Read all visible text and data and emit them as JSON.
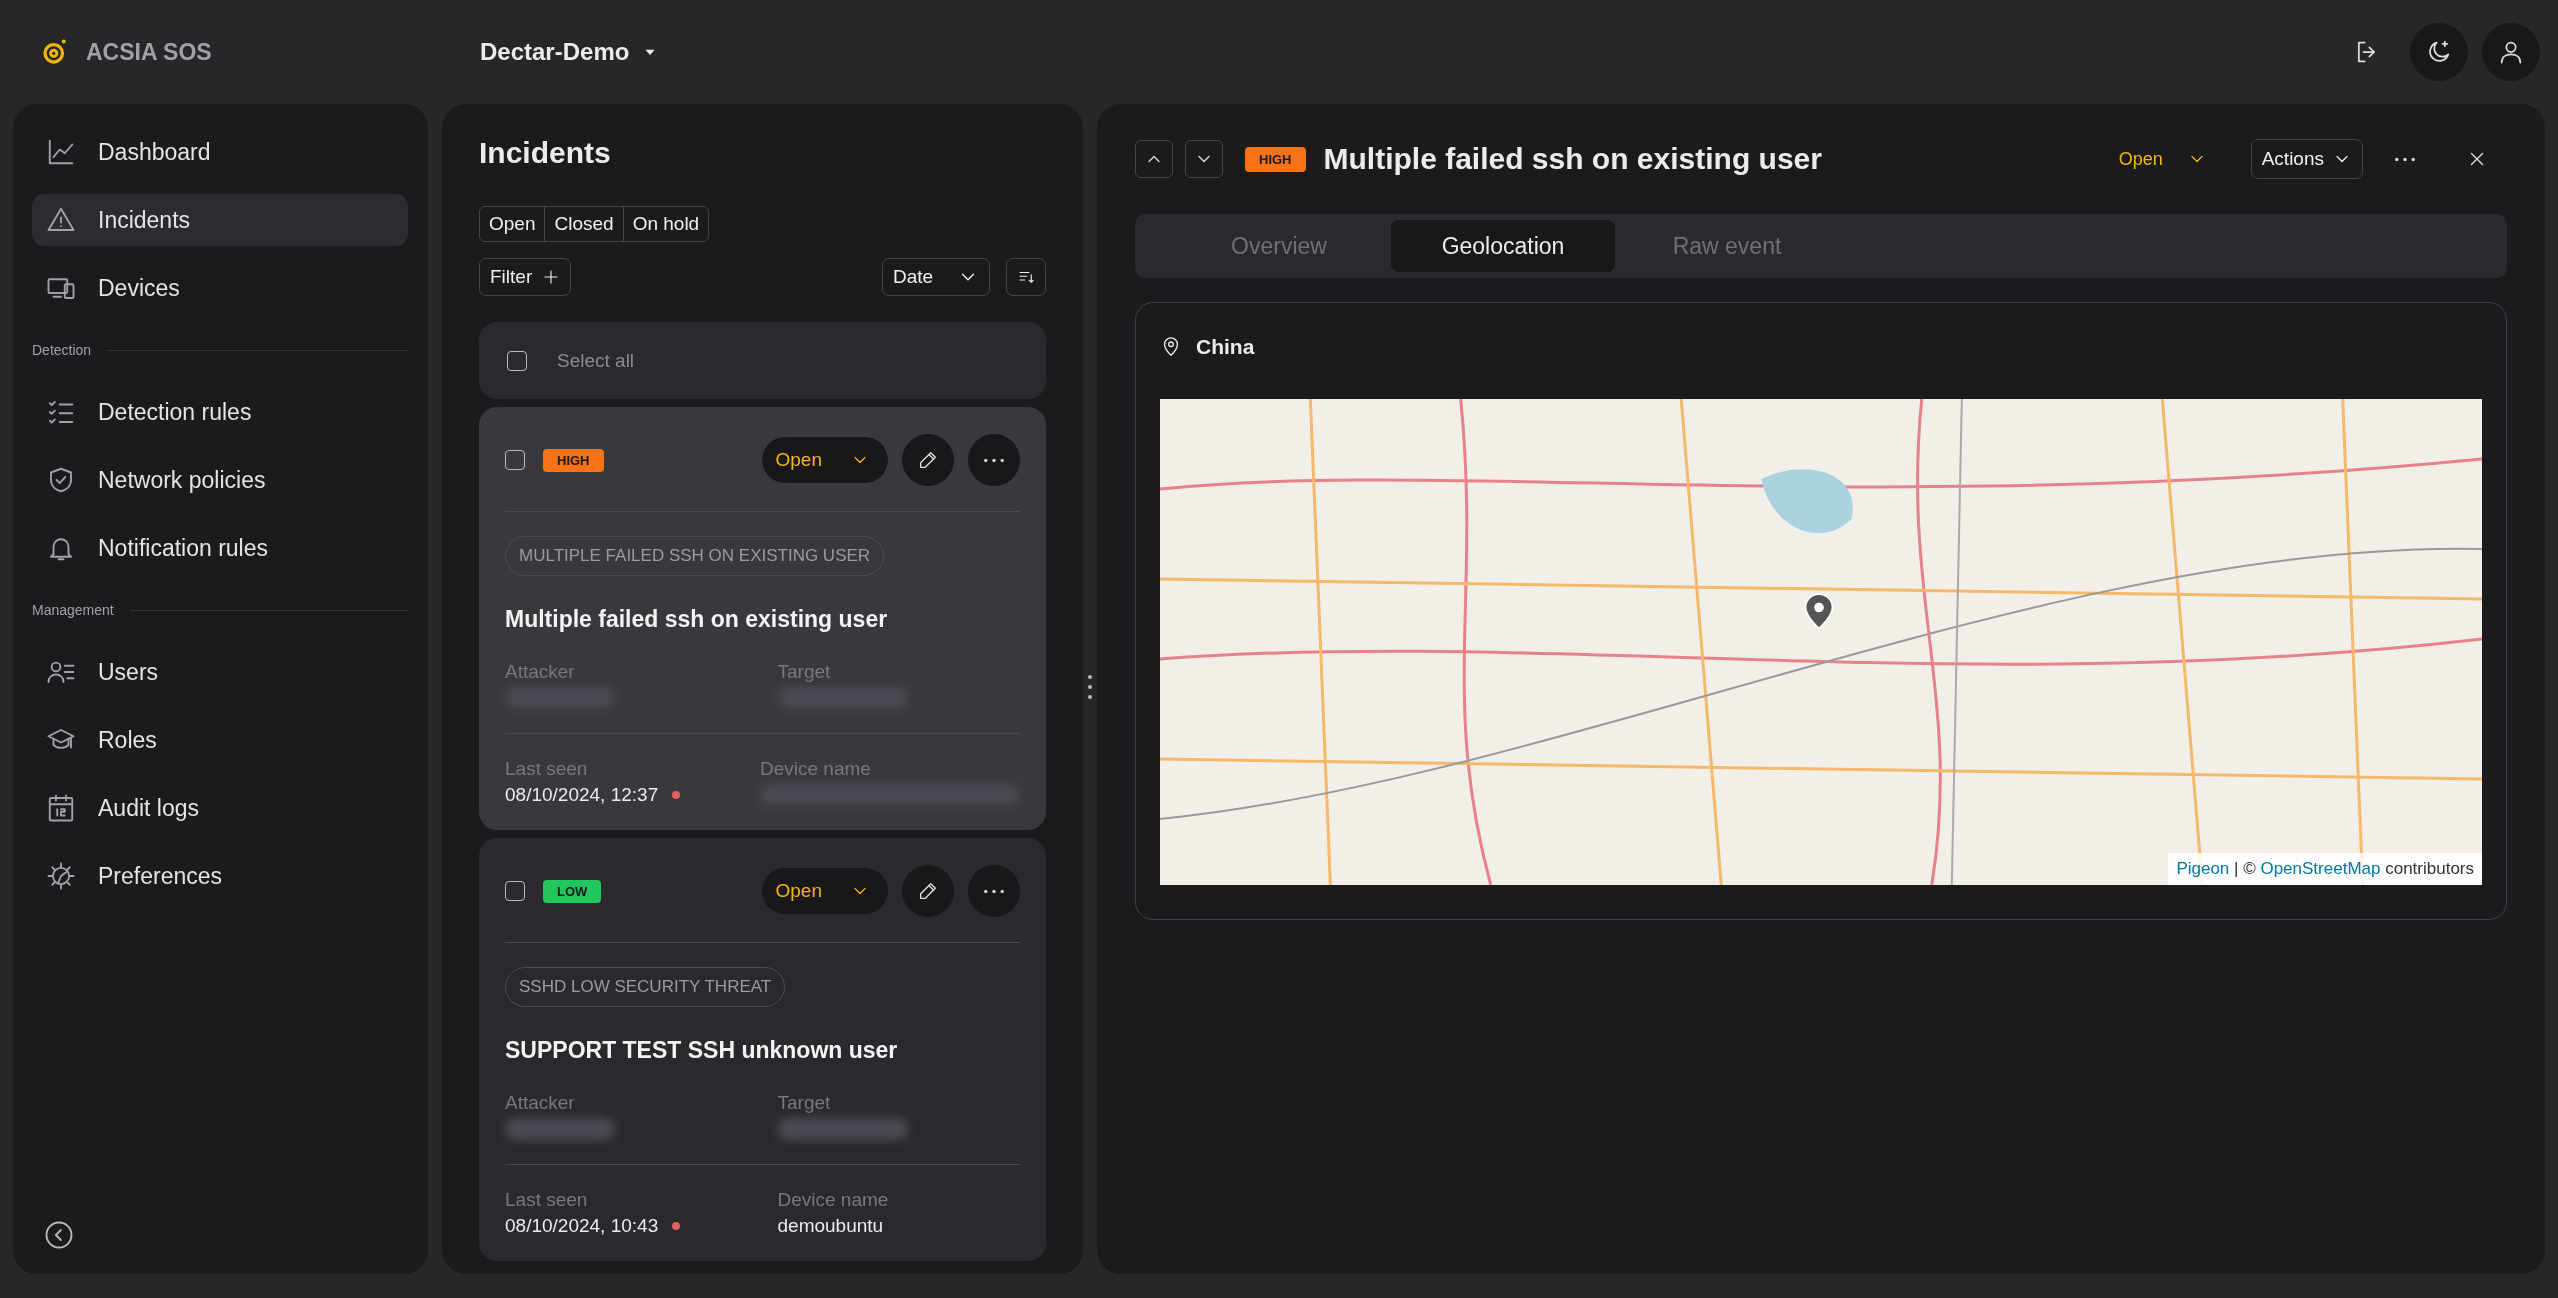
{
  "app": {
    "name": "ACSIA SOS",
    "workspace": "Dectar-Demo"
  },
  "sidebar": {
    "items": [
      {
        "kind": "item",
        "label": "Dashboard",
        "selected": false
      },
      {
        "kind": "item",
        "label": "Incidents",
        "selected": true
      },
      {
        "kind": "item",
        "label": "Devices",
        "selected": false
      },
      {
        "kind": "section",
        "label": "Detection"
      },
      {
        "kind": "item",
        "label": "Detection rules",
        "selected": false
      },
      {
        "kind": "item",
        "label": "Network policies",
        "selected": false
      },
      {
        "kind": "item",
        "label": "Notification rules",
        "selected": false
      },
      {
        "kind": "section",
        "label": "Management"
      },
      {
        "kind": "item",
        "label": "Users",
        "selected": false
      },
      {
        "kind": "item",
        "label": "Roles",
        "selected": false
      },
      {
        "kind": "item",
        "label": "Audit logs",
        "selected": false
      },
      {
        "kind": "item",
        "label": "Preferences",
        "selected": false
      }
    ]
  },
  "incidents": {
    "title": "Incidents",
    "status_filters": [
      {
        "label": "Open",
        "selected": false
      },
      {
        "label": "Closed",
        "selected": false
      },
      {
        "label": "On hold",
        "selected": false
      }
    ],
    "filter_button": "Filter",
    "sort": {
      "value": "Date"
    },
    "select_all": {
      "label": "Select all",
      "checked": false
    },
    "cards": [
      {
        "checked": false,
        "severity": "HIGH",
        "color": "#f97316",
        "status": "Open",
        "category": "MULTIPLE FAILED SSH ON EXISTING USER",
        "title": "Multiple failed ssh on existing user",
        "fields": [
          {
            "label": "Attacker",
            "blurred": true
          },
          {
            "label": "Target",
            "blurred": true
          },
          {
            "label": "Last seen",
            "value": "08/10/2024, 12:37",
            "flagged": true,
            "blurred": false
          },
          {
            "label": "Device name",
            "blurred": true
          }
        ],
        "selected": true
      },
      {
        "checked": false,
        "severity": "LOW",
        "color": "#22c55e",
        "status": "Open",
        "category": "SSHD LOW SECURITY THREAT",
        "title": "SUPPORT TEST SSH unknown user",
        "fields": [
          {
            "label": "Attacker",
            "blurred": true
          },
          {
            "label": "Target",
            "blurred": true
          },
          {
            "label": "Last seen",
            "value": "08/10/2024, 10:43",
            "flagged": true,
            "blurred": false
          },
          {
            "label": "Device name",
            "value": "demoubuntu",
            "blurred": false
          }
        ],
        "selected": false
      }
    ]
  },
  "detail": {
    "severity": "HIGH",
    "color": "#f97316",
    "title": "Multiple failed ssh on existing user",
    "status": "Open",
    "actions": "Actions",
    "tabs": [
      {
        "label": "Overview",
        "selected": false
      },
      {
        "label": "Geolocation",
        "selected": true
      },
      {
        "label": "Raw event",
        "selected": false
      }
    ],
    "location": "China",
    "attribution": [
      {
        "kind": "link",
        "text": "Pigeon"
      },
      {
        "kind": "text",
        "text": " | © "
      },
      {
        "kind": "link",
        "text": "OpenStreetMap"
      },
      {
        "kind": "text",
        "text": " contributors"
      }
    ]
  }
}
